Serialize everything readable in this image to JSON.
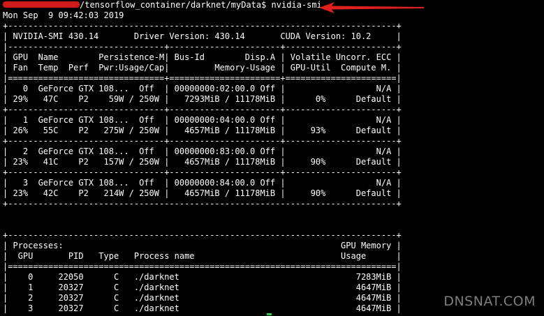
{
  "terminal": {
    "prompt_path": "/tensorflow_container/darknet/myData$ nvidia-smi",
    "date": "Mon Sep  9 09:42:03 2019",
    "border": "+-----------------------------------------------------------------------------+",
    "header_line": "| NVIDIA-SMI 430.14       Driver Version: 430.14       CUDA Version: 10.2     |",
    "header_sep": "|-------------------------------+----------------------+----------------------+",
    "col_header_1": "| GPU  Name        Persistence-M| Bus-Id        Disp.A | Volatile Uncorr. ECC |",
    "col_header_2": "| Fan  Temp  Perf  Pwr:Usage/Cap|         Memory-Usage | GPU-Util  Compute M. |",
    "double_sep": "|===============================+======================+======================|",
    "gpus": [
      {
        "line1": "|   0  GeForce GTX 108...  Off  | 00000000:02:00.0 Off |                  N/A |",
        "line2": "| 29%   47C    P2    59W / 250W |   7293MiB / 11178MiB |      0%      Default |"
      },
      {
        "line1": "|   1  GeForce GTX 108...  Off  | 00000000:04:00.0 Off |                  N/A |",
        "line2": "| 26%   55C    P2   275W / 250W |   4657MiB / 11178MiB |     93%      Default |"
      },
      {
        "line1": "|   2  GeForce GTX 108...  Off  | 00000000:83:00.0 Off |                  N/A |",
        "line2": "| 23%   41C    P2   157W / 250W |   4657MiB / 11178MiB |     90%      Default |"
      },
      {
        "line1": "|   3  GeForce GTX 108...  Off  | 00000000:84:00.0 Off |                  N/A |",
        "line2": "| 23%   42C    P2   214W / 250W |   4657MiB / 11178MiB |     90%      Default |"
      }
    ],
    "gpu_sep": "+-------------------------------+----------------------+----------------------+",
    "blank": " ",
    "proc_header_1": "| Processes:                                                       GPU Memory |",
    "proc_header_2": "|  GPU       PID   Type   Process name                             Usage      |",
    "proc_double_sep": "|=============================================================================|",
    "processes": [
      "|    0     22050      C   ./darknet                                   7283MiB |",
      "|    1     20327      C   ./darknet                                   4647MiB |",
      "|    2     20327      C   ./darknet                                   4647MiB |",
      "|    3     20327      C   ./darknet                                   4647MiB |"
    ]
  },
  "watermark": "DNSNAT.COM",
  "colors": {
    "background": "#000000",
    "text": "#ffffff",
    "annotation": "#e0201c",
    "cursor": "#2ecc40"
  }
}
